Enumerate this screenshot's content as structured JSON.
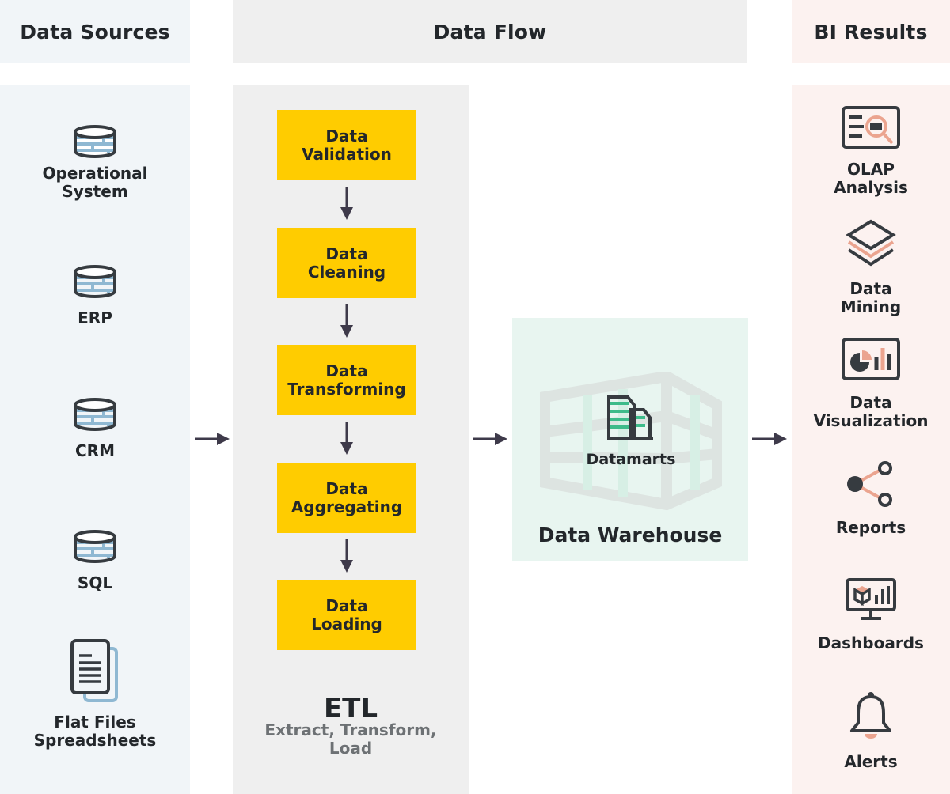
{
  "headers": {
    "sources": "Data Sources",
    "flow": "Data Flow",
    "results": "BI Results"
  },
  "sources": [
    {
      "label": "Operational\nSystem",
      "icon": "database-icon"
    },
    {
      "label": "ERP",
      "icon": "database-icon"
    },
    {
      "label": "CRM",
      "icon": "database-icon"
    },
    {
      "label": "SQL",
      "icon": "database-icon"
    },
    {
      "label": "Flat Files\nSpreadsheets",
      "icon": "document-icon"
    }
  ],
  "etl": {
    "steps": [
      {
        "label": "Data\nValidation"
      },
      {
        "label": "Data\nCleaning"
      },
      {
        "label": "Data\nTransforming"
      },
      {
        "label": "Data\nAggregating"
      },
      {
        "label": "Data\nLoading"
      }
    ],
    "title": "ETL",
    "subtitle": "Extract, Transform,\nLoad"
  },
  "warehouse": {
    "title": "Data Warehouse",
    "datamarts_label": "Datamarts"
  },
  "results": [
    {
      "label": "OLAP\nAnalysis",
      "icon": "olap-search-icon"
    },
    {
      "label": "Data\nMining",
      "icon": "layers-icon"
    },
    {
      "label": "Data\nVisualization",
      "icon": "chart-icon"
    },
    {
      "label": "Reports",
      "icon": "share-icon"
    },
    {
      "label": "Dashboards",
      "icon": "monitor-dashboard-icon"
    },
    {
      "label": "Alerts",
      "icon": "bell-icon"
    }
  ],
  "colors": {
    "step_fill": "#ffcc00",
    "text_dark": "#23272b",
    "icon_dark": "#363b40",
    "icon_blue": "#8fb8d2",
    "icon_green": "#3dbb8a",
    "icon_salmon": "#eba48f",
    "arrow": "#3e3a4a"
  }
}
